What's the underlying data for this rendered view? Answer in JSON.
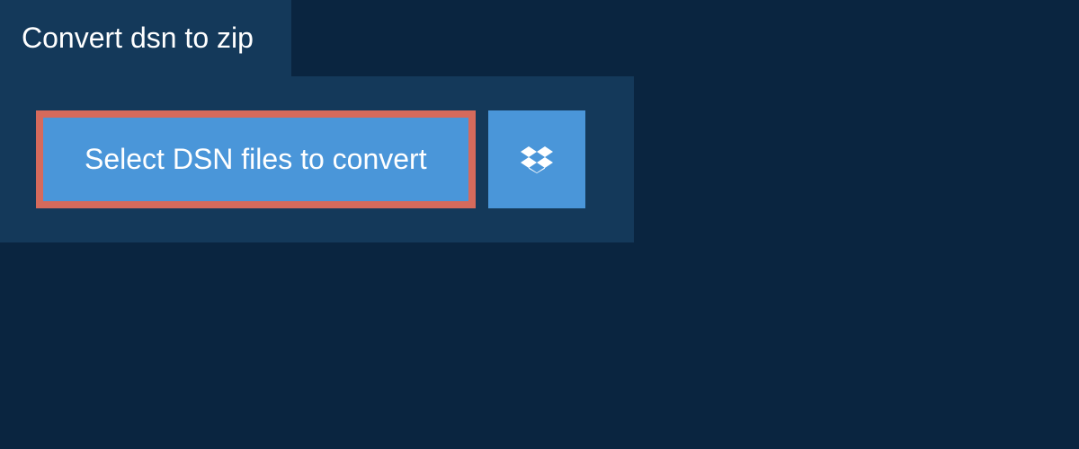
{
  "tab": {
    "label": "Convert dsn to zip"
  },
  "actions": {
    "select_files_label": "Select DSN files to convert"
  },
  "colors": {
    "background": "#0a2540",
    "panel": "#14395a",
    "button": "#4a96d9",
    "highlight_border": "#d56a5c"
  }
}
